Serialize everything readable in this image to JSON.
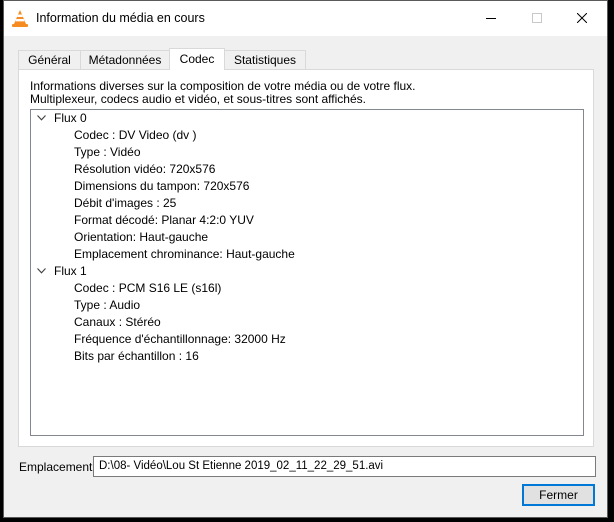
{
  "window": {
    "title": "Information du média en cours"
  },
  "tabs": [
    {
      "label": "Général"
    },
    {
      "label": "Métadonnées"
    },
    {
      "label": "Codec"
    },
    {
      "label": "Statistiques"
    }
  ],
  "active_tab": "Codec",
  "description": {
    "line1": "Informations diverses sur la composition de votre média ou de votre flux.",
    "line2": "Multiplexeur, codecs audio et vidéo, et sous-titres sont affichés."
  },
  "streams": [
    {
      "name": "Flux 0",
      "properties": [
        "Codec : DV Video (dv  )",
        "Type : Vidéo",
        "Résolution vidéo: 720x576",
        "Dimensions du tampon: 720x576",
        "Débit d'images : 25",
        "Format décodé: Planar 4:2:0 YUV",
        "Orientation: Haut-gauche",
        "Emplacement chrominance: Haut-gauche"
      ]
    },
    {
      "name": "Flux 1",
      "properties": [
        "Codec : PCM S16 LE (s16l)",
        "Type : Audio",
        "Canaux : Stéréo",
        "Fréquence d'échantillonnage: 32000 Hz",
        "Bits par échantillon : 16"
      ]
    }
  ],
  "location": {
    "label": "Emplacement :",
    "value": "D:\\08- Vidéo\\Lou St Etienne 2019_02_11_22_29_51.avi"
  },
  "buttons": {
    "close_label": "Fermer"
  },
  "colors": {
    "accent": "#0078d7",
    "window_bg": "#f0f0f0",
    "panel_bg": "#ffffff"
  },
  "icons": {
    "app": "vlc-cone-icon",
    "minimize": "minimize-icon",
    "maximize": "maximize-icon",
    "close": "close-icon",
    "expand": "chevron-down-icon"
  }
}
